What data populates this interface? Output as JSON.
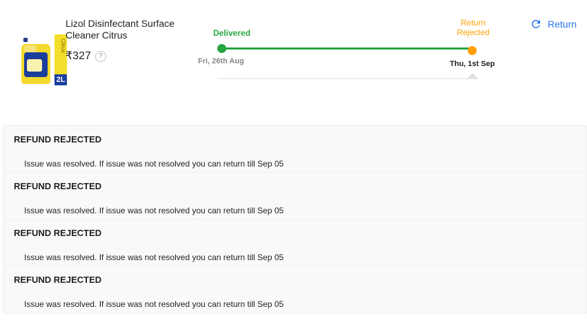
{
  "product": {
    "name": "Lizol Disinfectant Surface Cleaner Citrus",
    "price": "₹327",
    "help": "?",
    "image": {
      "side_text": "Citrus",
      "size": "2L"
    }
  },
  "timeline": {
    "start_status": "Delivered",
    "start_date": "Fri, 26th Aug",
    "end_status": "Return Rejected",
    "end_date": "Thu, 1st Sep",
    "colors": {
      "delivered": "#26a541",
      "rejected": "#ff9f00"
    }
  },
  "actions": {
    "return_label": "Return",
    "return_icon": "refresh-icon"
  },
  "refunds": [
    {
      "title": "REFUND REJECTED",
      "message": "Issue was resolved. If issue was not resolved you can return till Sep 05"
    },
    {
      "title": "REFUND REJECTED",
      "message": "Issue was resolved. If issue was not resolved you can return till Sep 05"
    },
    {
      "title": "REFUND REJECTED",
      "message": "Issue was resolved. If issue was not resolved you can return till Sep 05"
    },
    {
      "title": "REFUND REJECTED",
      "message": "Issue was resolved. If issue was not resolved you can return till Sep 05"
    }
  ]
}
